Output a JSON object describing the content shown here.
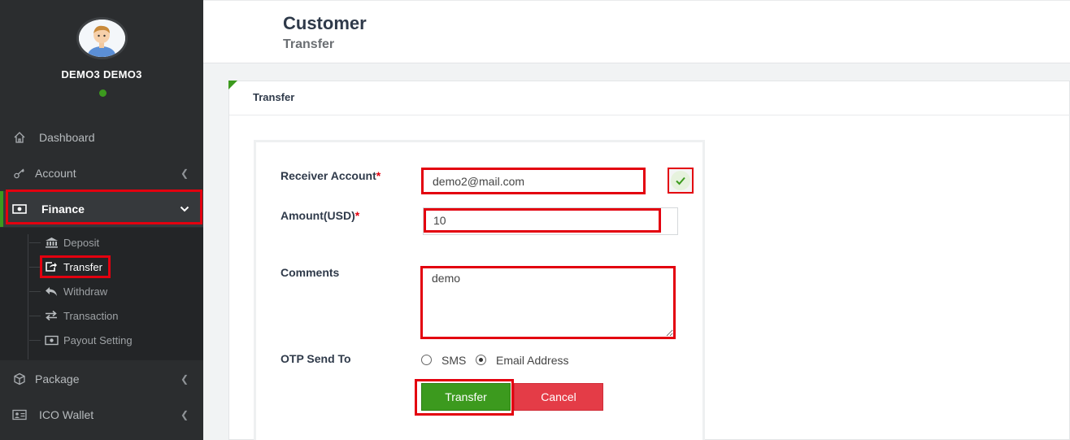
{
  "user": {
    "name": "DEMO3 DEMO3"
  },
  "sidebar": {
    "items": [
      {
        "label": "Dashboard",
        "icon": "home-icon"
      },
      {
        "label": "Account",
        "icon": "key-icon"
      },
      {
        "label": "Finance",
        "icon": "money-icon"
      },
      {
        "label": "Package",
        "icon": "cube-icon"
      },
      {
        "label": "ICO Wallet",
        "icon": "id-card-icon"
      }
    ],
    "finance_submenu": [
      {
        "label": "Deposit",
        "icon": "bank-icon"
      },
      {
        "label": "Transfer",
        "icon": "share-square-icon"
      },
      {
        "label": "Withdraw",
        "icon": "reply-icon"
      },
      {
        "label": "Transaction",
        "icon": "exchange-icon"
      },
      {
        "label": "Payout Setting",
        "icon": "money-icon"
      }
    ]
  },
  "header": {
    "title": "Customer",
    "subtitle": "Transfer"
  },
  "card": {
    "title": "Transfer"
  },
  "form": {
    "receiver_label": "Receiver Account",
    "receiver_value": "demo2@mail.com",
    "amount_label": "Amount(USD)",
    "amount_value": "10",
    "comments_label": "Comments",
    "comments_value": "demo",
    "otp_label": "OTP Send To",
    "otp_options": [
      "SMS",
      "Email Address"
    ],
    "otp_selected": "Email Address",
    "required_mark": "*",
    "transfer_button": "Transfer",
    "cancel_button": "Cancel"
  },
  "colors": {
    "sidebar_bg": "#2b2d2f",
    "accent_green": "#3c9a1e",
    "cancel_red": "#e43c47",
    "highlight_red": "#e3000f"
  }
}
